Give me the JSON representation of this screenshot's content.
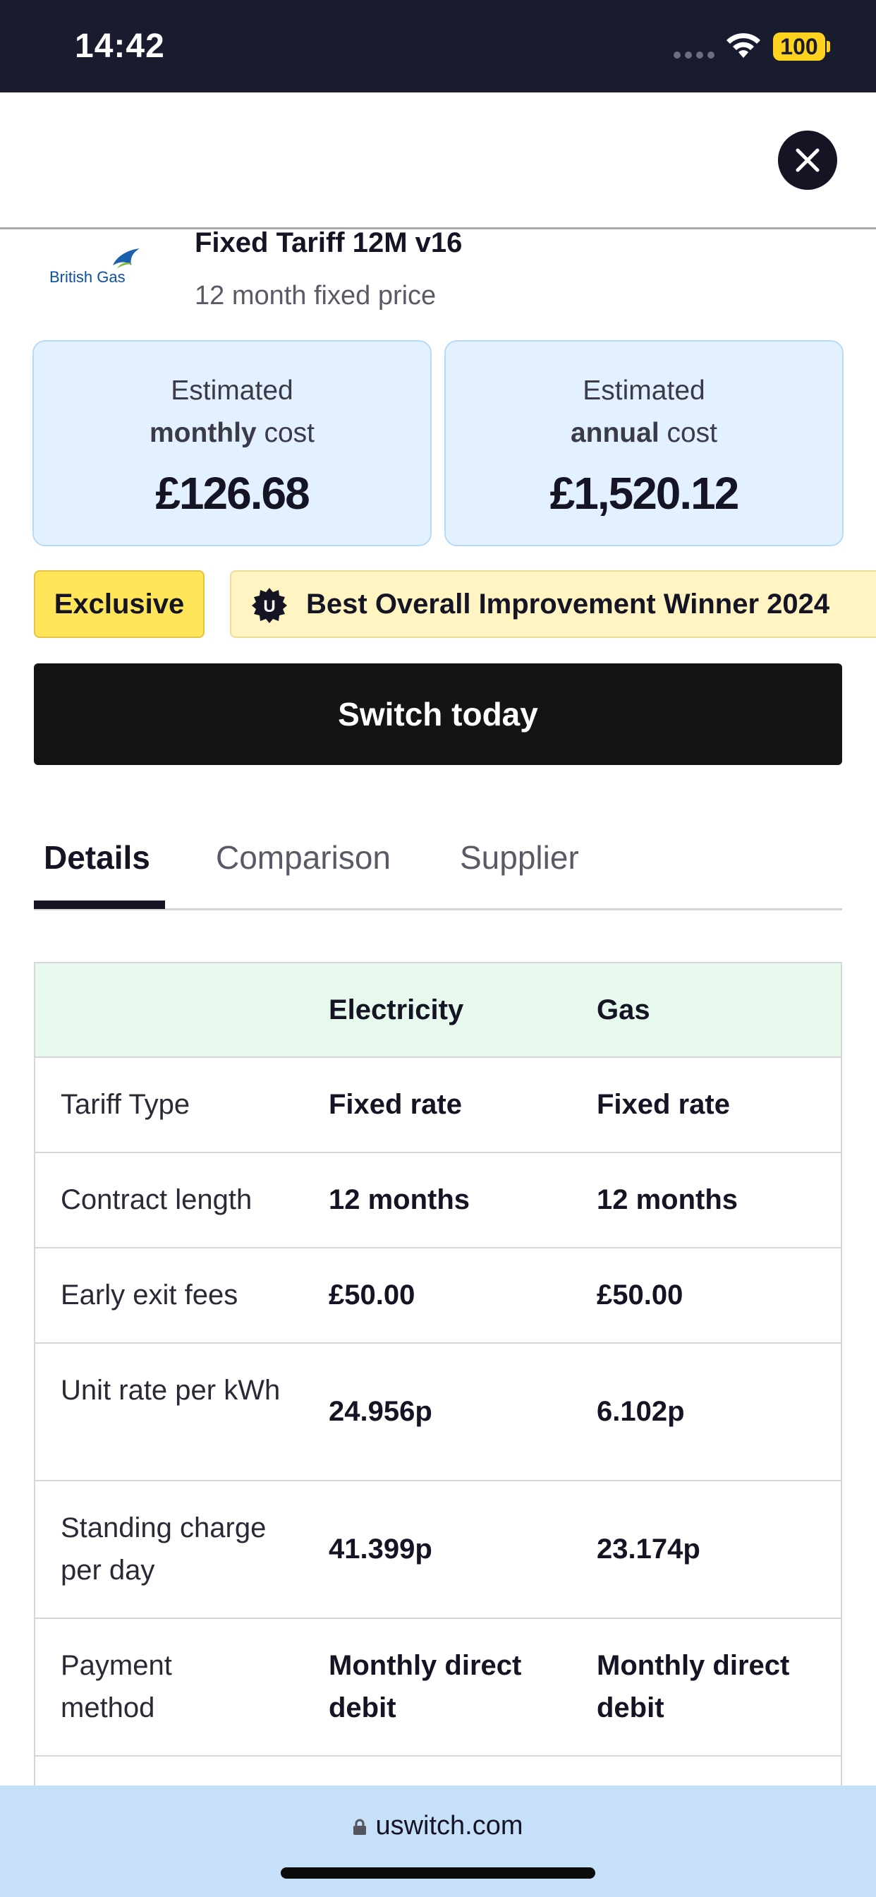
{
  "status_bar": {
    "time": "14:42",
    "battery": "100"
  },
  "tariff": {
    "supplier_logo_text": "British Gas",
    "name": "Fixed Tariff 12M v16",
    "subtitle": "12 month fixed price"
  },
  "costs": {
    "monthly": {
      "label_top": "Estimated",
      "label_bold": "monthly",
      "label_rest": " cost",
      "value": "£126.68"
    },
    "annual": {
      "label_top": "Estimated",
      "label_bold": "annual",
      "label_rest": " cost",
      "value": "£1,520.12"
    }
  },
  "badges": {
    "exclusive": "Exclusive",
    "award": "Best Overall Improvement Winner 2024",
    "award_icon_letter": "U"
  },
  "cta": {
    "label": "Switch today"
  },
  "tabs": [
    {
      "label": "Details",
      "active": true
    },
    {
      "label": "Comparison",
      "active": false
    },
    {
      "label": "Supplier",
      "active": false
    }
  ],
  "table": {
    "headers": [
      "",
      "Electricity",
      "Gas"
    ],
    "rows": [
      [
        "Tariff Type",
        "Fixed rate",
        "Fixed rate"
      ],
      [
        "Contract length",
        "12 months",
        "12 months"
      ],
      [
        "Early exit fees",
        "£50.00",
        "£50.00"
      ],
      [
        "Unit rate per kWh",
        "24.956p",
        "6.102p"
      ],
      [
        "Standing charge per day",
        "41.399p",
        "23.174p"
      ],
      [
        "Payment method",
        "Monthly direct debit",
        "Monthly direct debit"
      ]
    ]
  },
  "browser": {
    "url": "uswitch.com"
  },
  "colors": {
    "status_bar_bg": "#191b2e",
    "battery": "#ffd21f",
    "cost_card_bg": "#e3f0fd",
    "exclusive_badge": "#ffe55a",
    "award_badge": "#fff4c2",
    "cta_bg": "#141414",
    "table_header_bg": "#e6f9ec",
    "browser_bar_bg": "#c7e0fa"
  }
}
